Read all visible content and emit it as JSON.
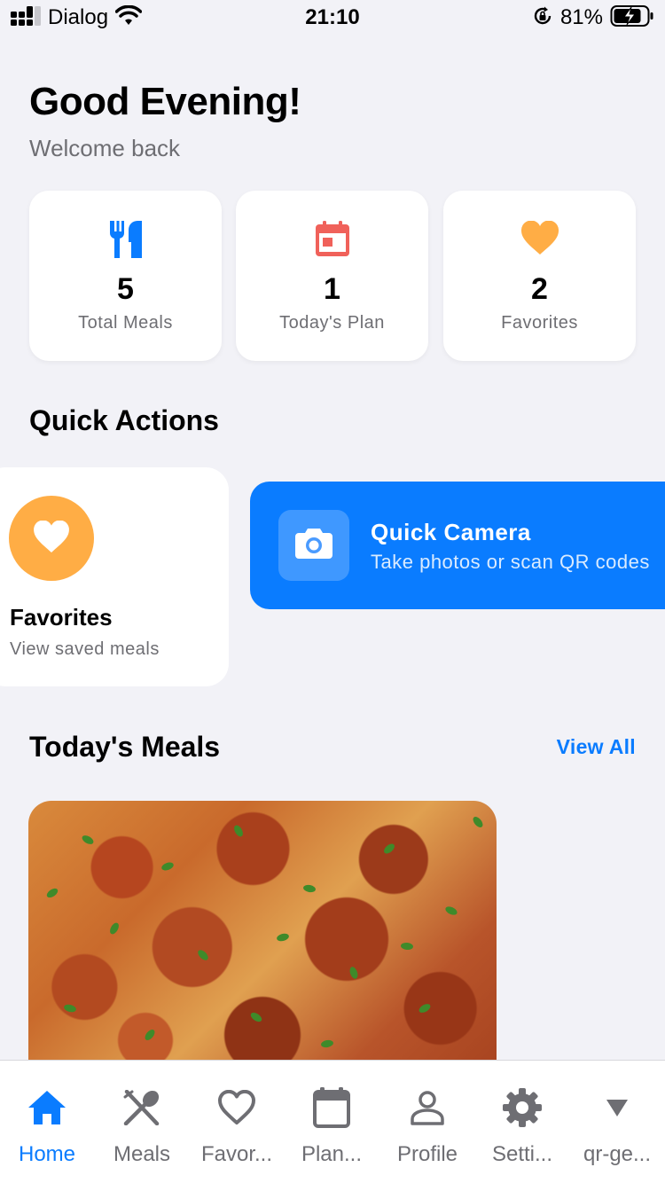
{
  "status_bar": {
    "carrier": "Dialog",
    "time": "21:10",
    "battery": "81%"
  },
  "header": {
    "greeting": "Good Evening!",
    "subtitle": "Welcome back"
  },
  "stats": [
    {
      "value": "5",
      "label": "Total Meals",
      "icon": "utensils-icon",
      "color": "#0a7cff"
    },
    {
      "value": "1",
      "label": "Today's Plan",
      "icon": "calendar-icon",
      "color": "#f0615a"
    },
    {
      "value": "2",
      "label": "Favorites",
      "icon": "heart-icon",
      "color": "#ffad45"
    }
  ],
  "quick_actions": {
    "title": "Quick Actions",
    "favorites": {
      "title": "Favorites",
      "subtitle": "View saved meals",
      "color": "#ffad45"
    },
    "camera": {
      "title": "Quick Camera",
      "subtitle": "Take photos or scan QR codes",
      "color": "#0a7cff"
    }
  },
  "todays_meals": {
    "title": "Today's Meals",
    "view_all": "View All"
  },
  "tab_bar": {
    "tabs": [
      {
        "label": "Home",
        "icon": "home-icon",
        "active": true
      },
      {
        "label": "Meals",
        "icon": "fork-spoon-icon",
        "active": false
      },
      {
        "label": "Favor...",
        "icon": "heart-outline-icon",
        "active": false
      },
      {
        "label": "Plan...",
        "icon": "calendar-outline-icon",
        "active": false
      },
      {
        "label": "Profile",
        "icon": "person-icon",
        "active": false
      },
      {
        "label": "Setti...",
        "icon": "gear-icon",
        "active": false
      },
      {
        "label": "qr-ge...",
        "icon": "triangle-down-icon",
        "active": false
      }
    ]
  },
  "colors": {
    "accent": "#0a7cff",
    "background": "#f2f2f7",
    "secondary_text": "#6e6e73"
  }
}
